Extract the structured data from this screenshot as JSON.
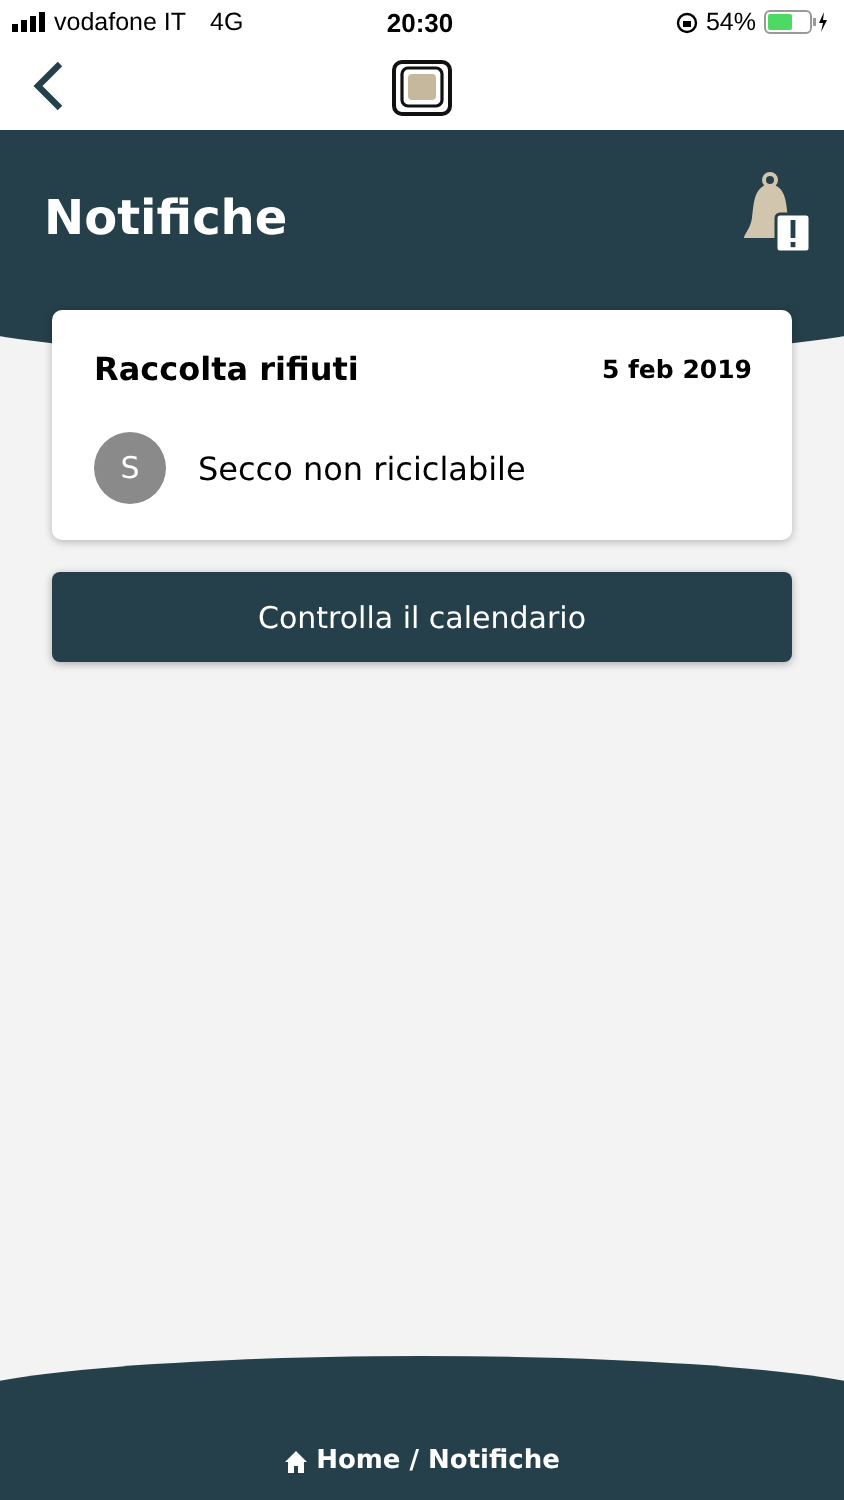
{
  "status_bar": {
    "carrier": "vodafone IT",
    "network": "4G",
    "time": "20:30",
    "battery": "54%"
  },
  "header": {
    "title": "Notifiche"
  },
  "notification": {
    "title": "Raccolta rifiuti",
    "date": "5 feb 2019",
    "avatar": "S",
    "text": "Secco non riciclabile"
  },
  "action_button": "Controlla il calendario",
  "breadcrumb": "Home / Notifiche"
}
